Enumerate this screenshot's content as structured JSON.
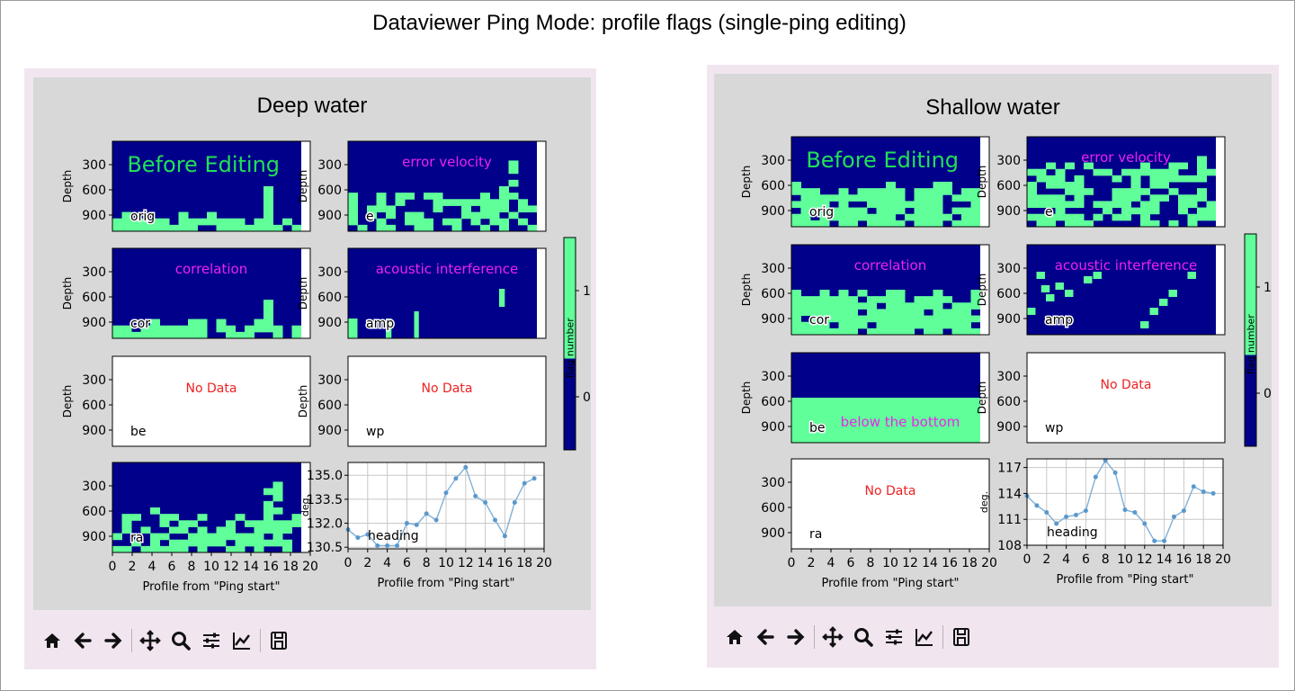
{
  "page_title": "Dataviewer Ping Mode: profile flags (single-ping editing)",
  "colors": {
    "flag_0": "#00008b",
    "flag_1": "#60ff9a",
    "panel_bg": "#f1e6f0",
    "figure_bg": "#d8d8d8",
    "magenta_label": "#ee22ee",
    "before_editing": "#22e055",
    "no_data": "#ee2222",
    "line": "#7fb0d8"
  },
  "toolbar": [
    {
      "name": "home-icon",
      "tooltip": "Home"
    },
    {
      "name": "back-arrow-icon",
      "tooltip": "Back"
    },
    {
      "name": "forward-arrow-icon",
      "tooltip": "Forward"
    },
    {
      "name": "pan-icon",
      "tooltip": "Pan"
    },
    {
      "name": "zoom-icon",
      "tooltip": "Zoom"
    },
    {
      "name": "configure-subplots-icon",
      "tooltip": "Subplots"
    },
    {
      "name": "edit-axis-icon",
      "tooltip": "Customize"
    },
    {
      "name": "save-icon",
      "tooltip": "Save"
    }
  ],
  "figures": [
    {
      "title": "Deep water",
      "colorbar": {
        "label": "flag number",
        "ticks": [
          "0",
          "1"
        ]
      },
      "subplots": [
        {
          "tag": "orig",
          "ylabel": "Depth",
          "yticks": [
            "300",
            "600",
            "900"
          ],
          "annotation": "Before Editing",
          "annotation_style": "green",
          "has_data": true,
          "xticks": false,
          "fill": "deep"
        },
        {
          "tag": "e",
          "ylabel": "Depth",
          "yticks": [
            "300",
            "600",
            "900"
          ],
          "annotation": "error velocity",
          "annotation_style": "magenta",
          "has_data": true,
          "xticks": false,
          "fill": "deep_sparse"
        },
        {
          "tag": "cor",
          "ylabel": "Depth",
          "yticks": [
            "300",
            "600",
            "900"
          ],
          "annotation": "correlation",
          "annotation_style": "magenta",
          "has_data": true,
          "xticks": false,
          "fill": "deep"
        },
        {
          "tag": "amp",
          "ylabel": "Depth",
          "yticks": [
            "300",
            "600",
            "900"
          ],
          "annotation": "acoustic interference",
          "annotation_style": "magenta",
          "has_data": true,
          "xticks": false,
          "fill": "amp_deep"
        },
        {
          "tag": "be",
          "ylabel": "Depth",
          "yticks": [
            "300",
            "600",
            "900"
          ],
          "annotation": "No Data",
          "annotation_style": "nodata",
          "has_data": false,
          "xticks": false
        },
        {
          "tag": "wp",
          "ylabel": "Depth",
          "yticks": [
            "300",
            "600",
            "900"
          ],
          "annotation": "No Data",
          "annotation_style": "nodata",
          "has_data": false,
          "xticks": false
        },
        {
          "tag": "ra",
          "ylabel": "",
          "yticks": [
            "300",
            "600",
            "900"
          ],
          "annotation": "",
          "annotation_style": "",
          "has_data": true,
          "xticks": true,
          "xlabel": "Profile from \"Ping start\"",
          "xtick_labels": [
            "0",
            "2",
            "4",
            "6",
            "8",
            "10",
            "12",
            "14",
            "16",
            "18",
            "20"
          ],
          "fill": "deep_sparse"
        }
      ],
      "heading": {
        "tag": "heading",
        "ylabel": "deg.",
        "xlabel": "Profile from \"Ping start\"",
        "xtick_labels": [
          "0",
          "2",
          "4",
          "6",
          "8",
          "10",
          "12",
          "14",
          "16",
          "18",
          "20"
        ],
        "yticks": [
          "130.5",
          "132.0",
          "133.5",
          "135.0"
        ],
        "ylim": [
          130.4,
          135.8
        ],
        "xlim": [
          0,
          20
        ],
        "x": [
          0,
          1,
          2,
          3,
          4,
          5,
          6,
          7,
          8,
          9,
          10,
          11,
          12,
          13,
          14,
          15,
          16,
          17,
          18,
          19
        ],
        "y": [
          131.6,
          131.1,
          131.3,
          130.6,
          130.6,
          130.6,
          132.0,
          131.9,
          132.6,
          132.2,
          133.9,
          134.8,
          135.5,
          133.7,
          133.3,
          132.2,
          131.2,
          133.3,
          134.5,
          134.8
        ]
      }
    },
    {
      "title": "Shallow water",
      "colorbar": {
        "label": "flag number",
        "ticks": [
          "0",
          "1"
        ]
      },
      "subplots": [
        {
          "tag": "orig",
          "ylabel": "Depth",
          "yticks": [
            "300",
            "600",
            "900"
          ],
          "annotation": "Before Editing",
          "annotation_style": "green",
          "has_data": true,
          "xticks": false,
          "fill": "shallow"
        },
        {
          "tag": "e",
          "ylabel": "Depth",
          "yticks": [
            "300",
            "600",
            "900"
          ],
          "annotation": "error velocity",
          "annotation_style": "magenta",
          "has_data": true,
          "xticks": false,
          "fill": "shallow_sparse"
        },
        {
          "tag": "cor",
          "ylabel": "Depth",
          "yticks": [
            "300",
            "600",
            "900"
          ],
          "annotation": "correlation",
          "annotation_style": "magenta",
          "has_data": true,
          "xticks": false,
          "fill": "shallow"
        },
        {
          "tag": "amp",
          "ylabel": "Depth",
          "yticks": [
            "300",
            "600",
            "900"
          ],
          "annotation": "acoustic interference",
          "annotation_style": "magenta",
          "has_data": true,
          "xticks": false,
          "fill": "amp_shallow"
        },
        {
          "tag": "be",
          "ylabel": "Depth",
          "yticks": [
            "300",
            "600",
            "900"
          ],
          "annotation": "below the bottom",
          "annotation_style": "magenta",
          "has_data": true,
          "xticks": false,
          "fill": "below"
        },
        {
          "tag": "wp",
          "ylabel": "Depth",
          "yticks": [
            "300",
            "600",
            "900"
          ],
          "annotation": "No Data",
          "annotation_style": "nodata",
          "has_data": false,
          "xticks": false
        },
        {
          "tag": "ra",
          "ylabel": "",
          "yticks": [
            "300",
            "600",
            "900"
          ],
          "annotation": "No Data",
          "annotation_style": "nodata",
          "has_data": false,
          "xticks": true,
          "xlabel": "Profile from \"Ping start\"",
          "xtick_labels": [
            "0",
            "2",
            "4",
            "6",
            "8",
            "10",
            "12",
            "14",
            "16",
            "18",
            "20"
          ]
        }
      ],
      "heading": {
        "tag": "heading",
        "ylabel": "deg.",
        "xlabel": "Profile from \"Ping start\"",
        "xtick_labels": [
          "0",
          "2",
          "4",
          "6",
          "8",
          "10",
          "12",
          "14",
          "16",
          "18",
          "20"
        ],
        "yticks": [
          "108",
          "111",
          "114",
          "117"
        ],
        "ylim": [
          108,
          118
        ],
        "xlim": [
          0,
          20
        ],
        "x": [
          0,
          1,
          2,
          3,
          4,
          5,
          6,
          7,
          8,
          9,
          10,
          11,
          12,
          13,
          14,
          15,
          16,
          17,
          18,
          19
        ],
        "y": [
          113.7,
          112.6,
          111.8,
          110.5,
          111.3,
          111.5,
          112.0,
          115.9,
          117.8,
          116.4,
          112.1,
          111.8,
          110.5,
          108.5,
          108.5,
          111.3,
          112.0,
          114.8,
          114.2,
          114.0
        ]
      }
    }
  ]
}
